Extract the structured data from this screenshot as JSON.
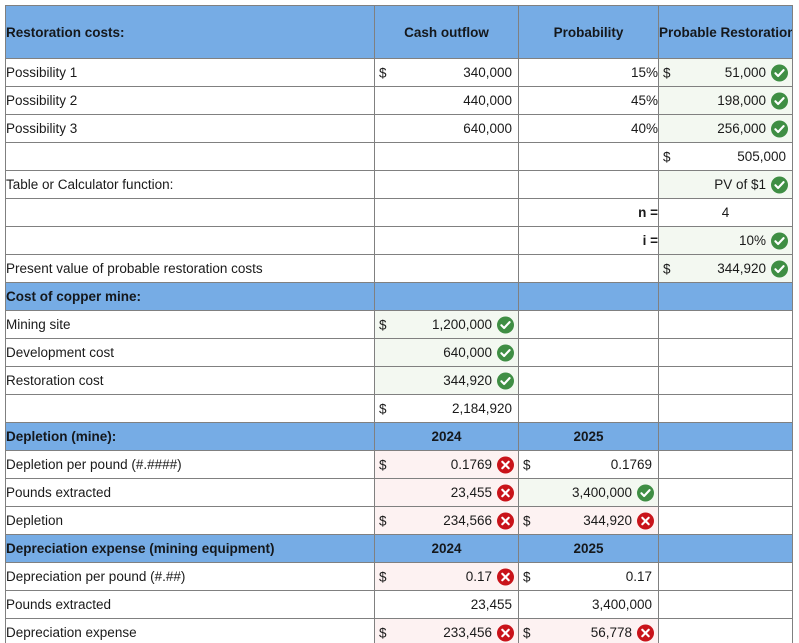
{
  "columns": {
    "label": "",
    "cash_outflow": "Cash outflow",
    "probability": "Probability",
    "probable_restoration_cost": "Probable Restoration Cost"
  },
  "colors": {
    "header_blue": "#76ACE5",
    "correct_fill": "#F3F8F1",
    "incorrect_fill": "#FDF2F2",
    "correct_icon": "#3F8E44",
    "incorrect_icon": "#C9131A"
  },
  "sections": {
    "restoration": {
      "title": "Restoration costs:",
      "rows": [
        {
          "label": "Possibility 1",
          "cash_currency": "$",
          "cash": "340,000",
          "probability": "15%",
          "prc_currency": "$",
          "prc": "51,000",
          "prc_status": "correct"
        },
        {
          "label": "Possibility 2",
          "cash_currency": "",
          "cash": "440,000",
          "probability": "45%",
          "prc_currency": "",
          "prc": "198,000",
          "prc_status": "correct"
        },
        {
          "label": "Possibility 3",
          "cash_currency": "",
          "cash": "640,000",
          "probability": "40%",
          "prc_currency": "",
          "prc": "256,000",
          "prc_status": "correct"
        }
      ],
      "total": {
        "label": "",
        "prc_currency": "$",
        "prc": "505,000",
        "prc_status": "none"
      },
      "calculator": {
        "label": "Table or Calculator function:",
        "value": "PV of $1",
        "status": "correct"
      },
      "n_row": {
        "label": "n =",
        "value": "4",
        "status": "none"
      },
      "i_row": {
        "label": "i =",
        "value": "10%",
        "status": "correct"
      },
      "present_value": {
        "label": "Present value of probable restoration costs",
        "currency": "$",
        "value": "344,920",
        "status": "correct"
      }
    },
    "cost_of_mine": {
      "title": "Cost of copper mine:",
      "rows": [
        {
          "label": "Mining site",
          "currency": "$",
          "value": "1,200,000",
          "status": "correct"
        },
        {
          "label": "Development cost",
          "currency": "",
          "value": "640,000",
          "status": "correct"
        },
        {
          "label": "Restoration cost",
          "currency": "",
          "value": "344,920",
          "status": "correct"
        }
      ],
      "total": {
        "label": "",
        "currency": "$",
        "value": "2,184,920",
        "status": "none"
      }
    },
    "depletion": {
      "title": "Depletion (mine):",
      "year_2024": "2024",
      "year_2025": "2025",
      "rows": [
        {
          "label": "Depletion per pound (#.####)",
          "y2024_currency": "$",
          "y2024": "0.1769",
          "y2024_status": "incorrect",
          "y2025_currency": "$",
          "y2025": "0.1769",
          "y2025_status": "none"
        },
        {
          "label": "Pounds extracted",
          "y2024_currency": "",
          "y2024": "23,455",
          "y2024_status": "incorrect",
          "y2025_currency": "",
          "y2025": "3,400,000",
          "y2025_status": "correct"
        },
        {
          "label": "Depletion",
          "y2024_currency": "$",
          "y2024": "234,566",
          "y2024_status": "incorrect",
          "y2025_currency": "$",
          "y2025": "344,920",
          "y2025_status": "incorrect"
        }
      ]
    },
    "depreciation": {
      "title": "Depreciation expense (mining equipment)",
      "year_2024": "2024",
      "year_2025": "2025",
      "rows": [
        {
          "label": "Depreciation per pound (#.##)",
          "y2024_currency": "$",
          "y2024": "0.17",
          "y2024_status": "incorrect",
          "y2025_currency": "$",
          "y2025": "0.17",
          "y2025_status": "none"
        },
        {
          "label": "Pounds extracted",
          "y2024_currency": "",
          "y2024": "23,455",
          "y2024_status": "none",
          "y2025_currency": "",
          "y2025": "3,400,000",
          "y2025_status": "none"
        },
        {
          "label": "Depreciation expense",
          "y2024_currency": "$",
          "y2024": "233,456",
          "y2024_status": "incorrect",
          "y2025_currency": "$",
          "y2025": "56,778",
          "y2025_status": "incorrect"
        }
      ]
    }
  },
  "icons": {
    "correct": "check-circle-icon",
    "incorrect": "x-circle-icon"
  }
}
